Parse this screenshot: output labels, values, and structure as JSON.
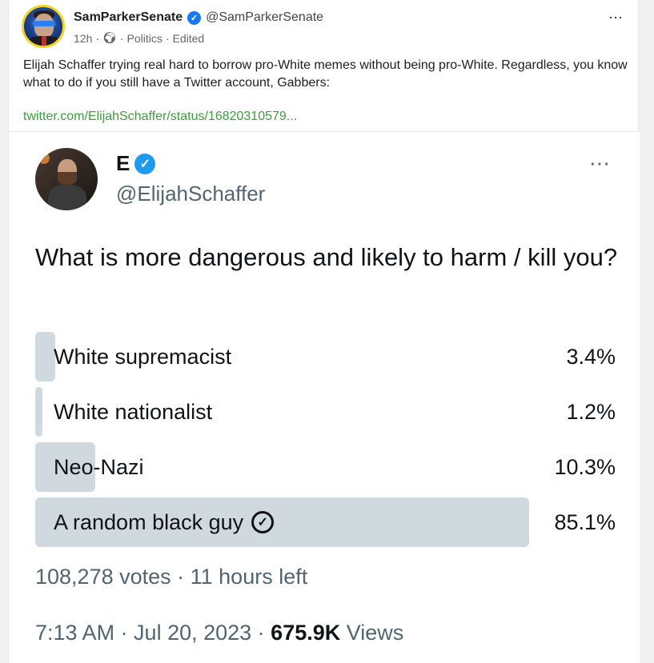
{
  "post": {
    "author_name": "SamParkerSenate",
    "author_handle": "@SamParkerSenate",
    "time_ago": "12h",
    "category": "Politics",
    "edited": "Edited",
    "text": "Elijah Schaffer trying real hard to borrow pro-White memes without being pro-White. Regardless, you know what to do if you still have a Twitter account, Gabbers:",
    "link": "twitter.com/ElijahSchaffer/status/16820310579...",
    "more_icon": "⋯"
  },
  "tweet": {
    "name": "E",
    "handle": "@ElijahSchaffer",
    "more_icon": "⋯",
    "question": "What is more dangerous and likely to harm / kill you?",
    "options": [
      {
        "label": "White supremacist",
        "percent": "3.4%",
        "fraction": 0.034
      },
      {
        "label": "White nationalist",
        "percent": "1.2%",
        "fraction": 0.012
      },
      {
        "label": "Neo-Nazi",
        "percent": "10.3%",
        "fraction": 0.103
      },
      {
        "label": "A random black guy",
        "percent": "85.1%",
        "fraction": 0.851
      }
    ],
    "votes_line": "108,278 votes · 11 hours left",
    "time_line": "7:13 AM · Jul 20, 2023 · ",
    "views_count": "675.9K",
    "views_label": " Views"
  },
  "colors": {
    "verified_facebook": "#1877f2",
    "verified_twitter": "#1d9bf0",
    "link_green": "#3b9e3b",
    "poll_fill": "#cfd9de"
  }
}
